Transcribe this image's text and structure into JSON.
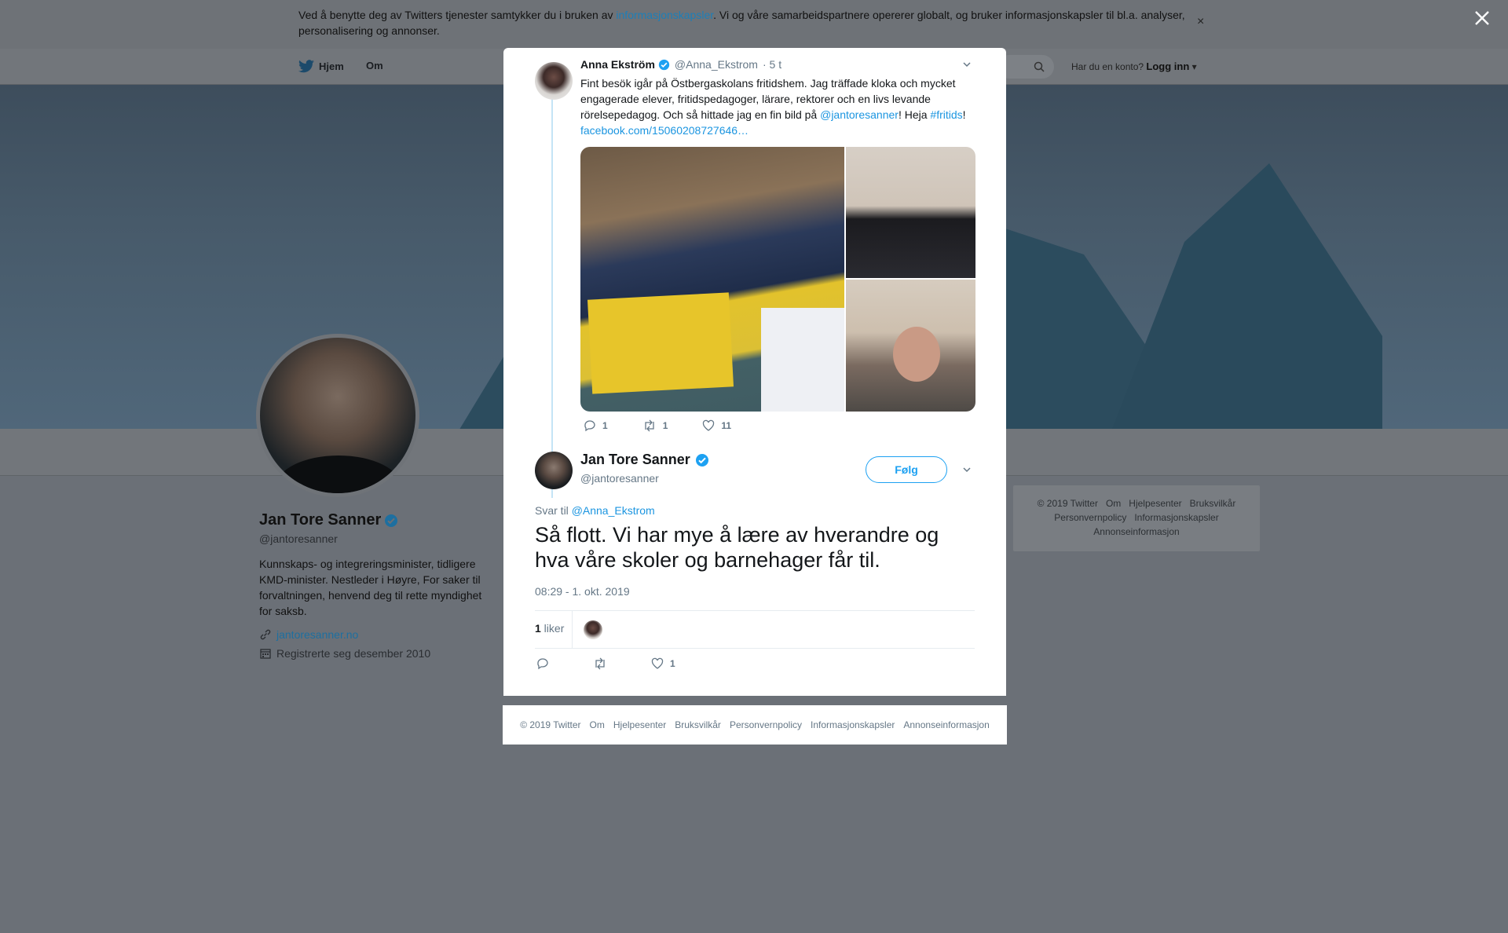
{
  "cookie_bar": {
    "text_before": "Ved å benytte deg av Twitters tjenester samtykker du i bruken av ",
    "link": "informasjonskapsler",
    "text_after": ". Vi og våre samarbeidspartnere opererer globalt, og bruker informasjonskapsler til bl.a. analyser, personalisering og annonser.",
    "close": "×"
  },
  "nav": {
    "home": "Hjem",
    "about": "Om",
    "account_prompt": "Har du en konto?",
    "login": "Logg inn"
  },
  "profile": {
    "name": "Jan Tore Sanner",
    "handle": "@jantoresanner",
    "bio": "Kunnskaps- og integreringsminister, tidligere KMD-minister. Nestleder i Høyre, For saker til forvaltningen, henvend deg til rette myndighet for saksb.",
    "website": "jantoresanner.no",
    "joined": "Registrerte seg desember 2010"
  },
  "side_footer": {
    "items": [
      "© 2019 Twitter",
      "Om",
      "Hjelpesenter",
      "Bruksvilkår",
      "Personvernpolicy",
      "Informasjonskapsler",
      "Annonseinformasjon"
    ]
  },
  "parent_tweet": {
    "name": "Anna Ekström",
    "handle": "@Anna_Ekstrom",
    "time": "· 5 t",
    "text_1": "Fint besök igår på Östbergaskolans fritidshem. Jag träffade kloka och mycket engagerade elever, fritidspedagoger, lärare, rektorer och en livs levande rörelsepedagog. Och så hittade jag en fin bild på ",
    "mention": "@jantoresanner",
    "text_2": "! Heja ",
    "hashtag": "#fritids",
    "text_3": "!",
    "link": "facebook.com/15060208727646…",
    "replies": "1",
    "retweets": "1",
    "likes": "11"
  },
  "main_tweet": {
    "name": "Jan Tore Sanner",
    "handle": "@jantoresanner",
    "follow_label": "Følg",
    "reply_prefix": "Svar til ",
    "reply_to": "@Anna_Ekstrom",
    "text": "Så flott. Vi har mye å lære av hverandre og hva våre skoler og barnehager får til.",
    "timestamp": "08:29 - 1. okt. 2019",
    "likes_count": "1",
    "likes_label": " liker",
    "like_action_count": "1"
  },
  "modal_footer": {
    "items": [
      "© 2019 Twitter",
      "Om",
      "Hjelpesenter",
      "Bruksvilkår",
      "Personvernpolicy",
      "Informasjonskapsler",
      "Annonseinformasjon"
    ]
  },
  "colors": {
    "accent": "#1da1f2",
    "link": "#1b95e0",
    "overlay": "#6b7077"
  }
}
